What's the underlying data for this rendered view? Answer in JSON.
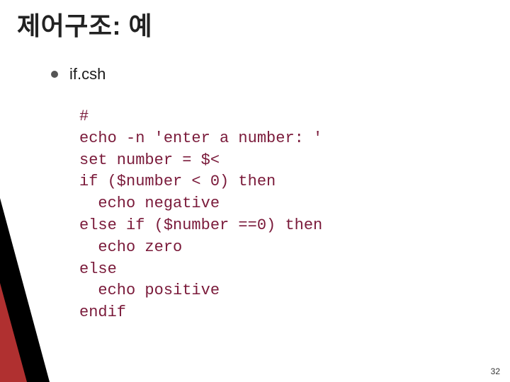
{
  "title": "제어구조: 예",
  "bullet": {
    "label": "if.csh"
  },
  "code": {
    "lines": [
      "#",
      "echo -n 'enter a number: '",
      "set number = $<",
      "if ($number < 0) then",
      "  echo negative",
      "else if ($number ==0) then",
      "  echo zero",
      "else",
      "  echo positive",
      "endif"
    ]
  },
  "page_number": "32"
}
